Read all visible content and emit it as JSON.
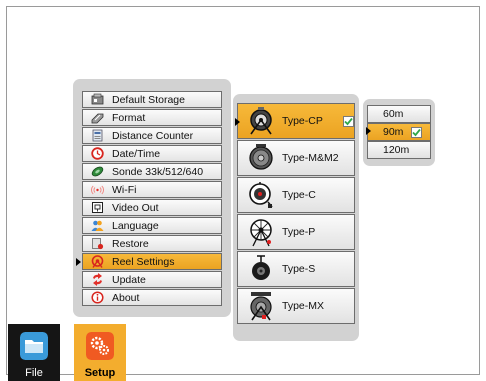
{
  "menu": {
    "items": [
      {
        "label": "Default Storage",
        "icon": "storage-icon"
      },
      {
        "label": "Format",
        "icon": "format-icon"
      },
      {
        "label": "Distance Counter",
        "icon": "counter-icon"
      },
      {
        "label": "Date/Time",
        "icon": "clock-icon"
      },
      {
        "label": "Sonde 33k/512/640",
        "icon": "sonde-icon"
      },
      {
        "label": "Wi-Fi",
        "icon": "wifi-icon"
      },
      {
        "label": "Video Out",
        "icon": "video-out-icon"
      },
      {
        "label": "Language",
        "icon": "language-icon"
      },
      {
        "label": "Restore",
        "icon": "restore-icon"
      },
      {
        "label": "Reel Settings",
        "icon": "reel-icon"
      },
      {
        "label": "Update",
        "icon": "update-icon"
      },
      {
        "label": "About",
        "icon": "info-icon"
      }
    ],
    "selected": "Reel Settings"
  },
  "reels": {
    "items": [
      "Type-CP",
      "Type-M&M2",
      "Type-C",
      "Type-P",
      "Type-S",
      "Type-MX"
    ],
    "selected": "Type-CP"
  },
  "lengths": {
    "items": [
      "60m",
      "90m",
      "120m"
    ],
    "selected": "90m"
  },
  "tabs": {
    "file": "File",
    "setup": "Setup",
    "active": "Setup"
  },
  "colors": {
    "highlight": "#f0aa2c",
    "panel": "#d2d2d2",
    "check": "#2fa84a"
  }
}
